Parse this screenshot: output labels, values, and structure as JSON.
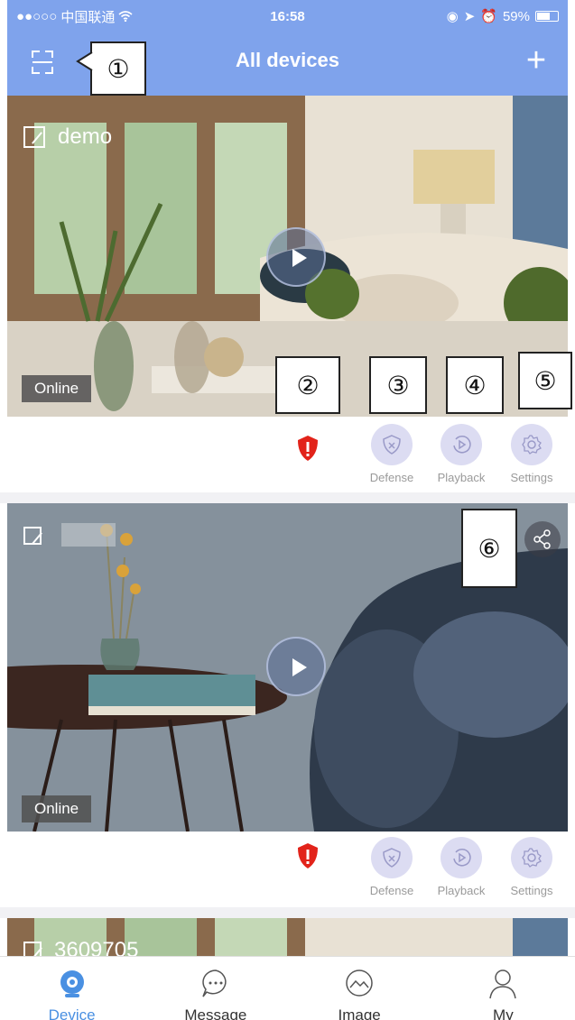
{
  "status_bar": {
    "carrier": "中国联通",
    "time": "16:58",
    "battery": "59%"
  },
  "nav": {
    "title": "All devices",
    "add_label": "+"
  },
  "callouts": [
    "①",
    "②",
    "③",
    "④",
    "⑤",
    "⑥"
  ],
  "devices": [
    {
      "name": "demo",
      "status": "Online",
      "actions": [
        {
          "label": "Defense",
          "icon": "shield-x-icon"
        },
        {
          "label": "Playback",
          "icon": "replay-icon"
        },
        {
          "label": "Settings",
          "icon": "gear-icon"
        }
      ]
    },
    {
      "name": "",
      "status": "Online",
      "actions": [
        {
          "label": "Defense",
          "icon": "shield-x-icon"
        },
        {
          "label": "Playback",
          "icon": "replay-icon"
        },
        {
          "label": "Settings",
          "icon": "gear-icon"
        }
      ]
    },
    {
      "name": "3609705"
    }
  ],
  "tabs": [
    {
      "label": "Device",
      "icon": "camera-icon",
      "active": true
    },
    {
      "label": "Message",
      "icon": "chat-bubble-icon",
      "active": false
    },
    {
      "label": "Image",
      "icon": "image-icon",
      "active": false
    },
    {
      "label": "My",
      "icon": "person-icon",
      "active": false
    }
  ],
  "colors": {
    "header": "#7fa3ec",
    "accent": "#4a90e2",
    "alarm": "#e2231a",
    "action_circle": "#dcdcf2"
  }
}
